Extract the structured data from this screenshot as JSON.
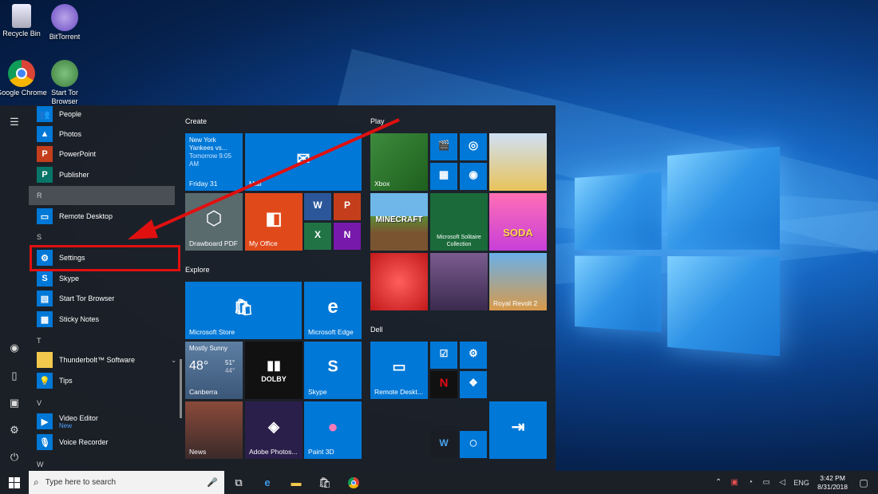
{
  "desktop_icons": [
    {
      "label": "Recycle Bin",
      "icon": "recycle-bin-icon"
    },
    {
      "label": "BitTorrent",
      "icon": "bittorrent-icon"
    },
    {
      "label": "Google Chrome",
      "icon": "chrome-icon"
    },
    {
      "label": "Start Tor Browser",
      "icon": "tor-icon"
    }
  ],
  "app_list": {
    "people": "People",
    "photos": "Photos",
    "powerpoint": "PowerPoint",
    "publisher": "Publisher",
    "letter_r": "R",
    "remote_desktop": "Remote Desktop",
    "letter_s": "S",
    "settings": "Settings",
    "skype": "Skype",
    "tor": "Start Tor Browser",
    "sticky": "Sticky Notes",
    "letter_t": "T",
    "thunderbolt": "Thunderbolt™ Software",
    "tips": "Tips",
    "letter_v": "V",
    "video_editor": "Video Editor",
    "video_editor_badge": "New",
    "voice_recorder": "Voice Recorder",
    "letter_w": "W"
  },
  "groups": {
    "create": "Create",
    "play": "Play",
    "explore": "Explore",
    "dell": "Dell"
  },
  "tiles": {
    "calendar_line1": "New York",
    "calendar_line2": "Yankees vs...",
    "calendar_line3": "Tomorrow 9:05",
    "calendar_line4": "AM",
    "calendar_day": "Friday 31",
    "mail": "Mail",
    "drawboard": "Drawboard PDF",
    "my_office": "My Office",
    "xbox": "Xbox",
    "minecraft": "MINECRAFT",
    "solitaire": "Microsoft Solitaire Collection",
    "candy": "SODA",
    "royal": "Royal Revolt 2",
    "store": "Microsoft Store",
    "edge": "Microsoft Edge",
    "weather_cond": "Mostly Sunny",
    "weather_temp": "48°",
    "weather_hi": "51°",
    "weather_lo": "44°",
    "weather_city": "Canberra",
    "dolby": "DOLBY",
    "skype": "Skype",
    "news": "News",
    "photoshop": "Adobe Photos...",
    "paint3d": "Paint 3D",
    "remote_desk": "Remote Deskt..."
  },
  "taskbar": {
    "search_placeholder": "Type here to search",
    "language": "ENG",
    "time": "3:42 PM",
    "date": "8/31/2018"
  }
}
